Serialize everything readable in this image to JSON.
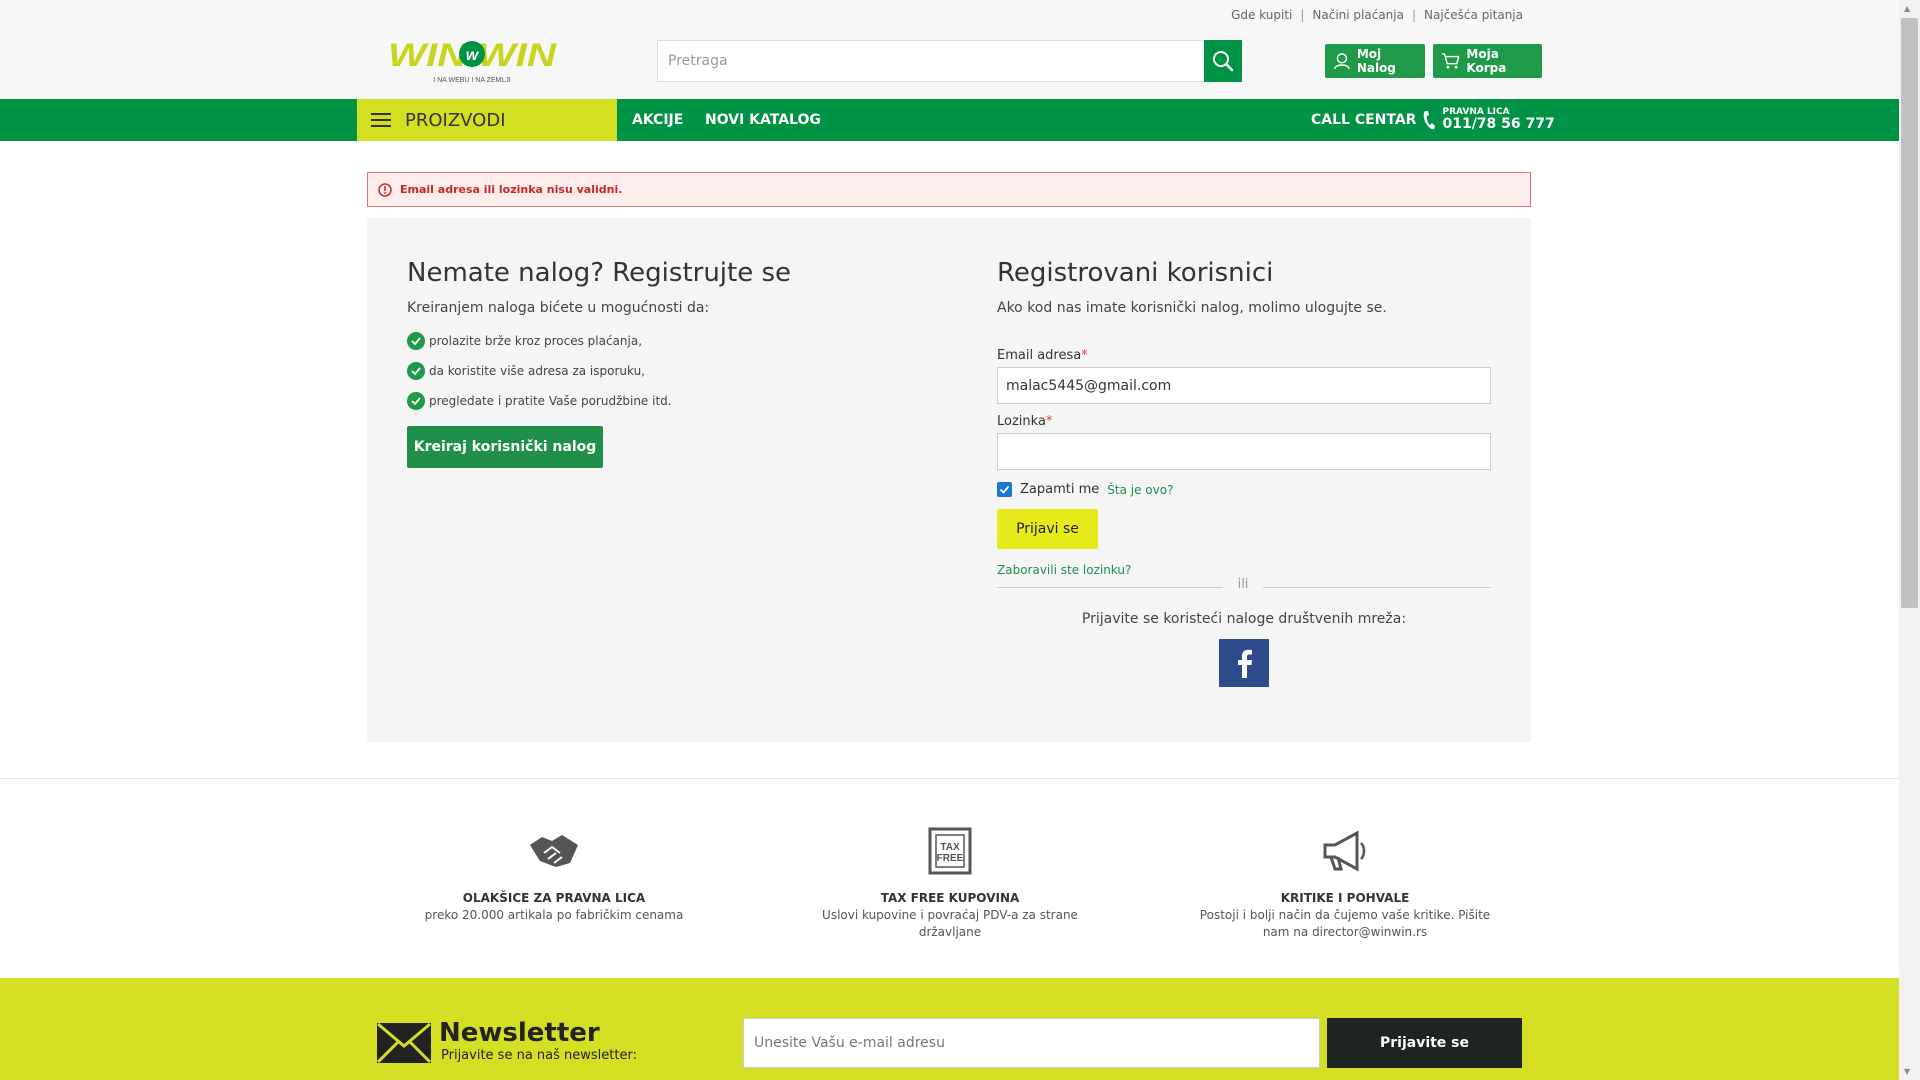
{
  "header": {
    "top_links": [
      "Gde kupiti",
      "Načini plaćanja",
      "Najčešća pitanja"
    ],
    "logo_text": "WIN WIN",
    "logo_tagline": "I NA WEBU I NA ZEMLJI",
    "search_placeholder": "Pretraga",
    "account_label": "Moj Nalog",
    "cart_label": "Moja Korpa"
  },
  "nav": {
    "products_label": "PROIZVODI",
    "links": [
      "AKCIJE",
      "NOVI KATALOG"
    ],
    "call_center_label": "CALL CENTAR",
    "call_center_small": "PRAVNA LICA",
    "call_center_phone": "011/78 56 777"
  },
  "error": {
    "message": "Email adresa ili lozinka nisu validni."
  },
  "register": {
    "title": "Nemate nalog? Registrujte se",
    "lead": "Kreiranjem naloga bićete u mogućnosti da:",
    "benefits": [
      "prolazite brže kroz proces plaćanja,",
      "da koristite više adresa za isporuku,",
      "pregledate i pratite Vaše porudžbine itd."
    ],
    "button": "Kreiraj korisnički nalog"
  },
  "login": {
    "title": "Registrovani korisnici",
    "lead": "Ako kod nas imate korisnički nalog, molimo ulogujte se.",
    "email_label": "Email adresa",
    "email_value": "malac5445@gmail.com",
    "password_label": "Lozinka",
    "password_value": "",
    "required_mark": "*",
    "remember_label": "Zapamti me",
    "remember_checked": true,
    "whats_this": "Šta je ovo?",
    "submit": "Prijavi se",
    "forgot": "Zaboravili ste lozinku?",
    "or": "ili",
    "social_text": "Prijavite se koristeći naloge društvenih mreža:"
  },
  "features": [
    {
      "icon": "handshake-icon",
      "title": "OLAKŠICE ZA PRAVNA LICA",
      "desc": "preko 20.000 artikala po fabričkim cenama"
    },
    {
      "icon": "tax-free-icon",
      "title": "TAX FREE KUPOVINA",
      "desc": "Uslovi kupovine i povraćaj PDV-a za strane državljane"
    },
    {
      "icon": "megaphone-icon",
      "title": "KRITIKE I POHVALE",
      "desc": "Postoji i bolji način da čujemo vaše kritike. Pišite nam na director@winwin.rs"
    }
  ],
  "newsletter": {
    "title": "Newsletter",
    "subtitle": "Prijavite se na naš newsletter:",
    "placeholder": "Unesite Vašu e-mail adresu",
    "button": "Prijavite se"
  },
  "colors": {
    "green": "#009245",
    "lime": "#d4de23",
    "button_yellow": "#e6ea1b",
    "error_red": "#c62828",
    "facebook": "#2d4a8a"
  }
}
